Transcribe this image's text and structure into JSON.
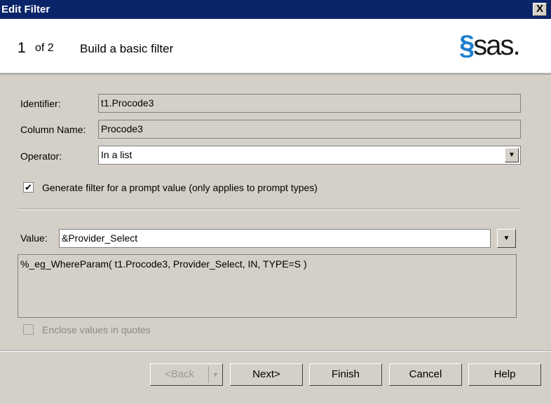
{
  "window": {
    "title": "Edit Filter",
    "close": "X"
  },
  "header": {
    "step": "1",
    "of": "of 2",
    "title": "Build a basic filter",
    "logo": "sas"
  },
  "form": {
    "identifier_label": "Identifier:",
    "identifier_value": "t1.Procode3",
    "column_label": "Column Name:",
    "column_value": "Procode3",
    "operator_label": "Operator:",
    "operator_value": "In a list",
    "prompt_checkbox_label": "Generate filter for a prompt value (only applies to prompt types)",
    "prompt_checked": true,
    "value_label": "Value:",
    "value_value": "&Provider_Select",
    "expression": "%_eg_WhereParam( t1.Procode3, Provider_Select, IN, TYPE=S )",
    "quotes_label": "Enclose values in quotes",
    "quotes_checked": false
  },
  "buttons": {
    "back": "<Back",
    "next": "Next>",
    "finish": "Finish",
    "cancel": "Cancel",
    "help": "Help"
  }
}
